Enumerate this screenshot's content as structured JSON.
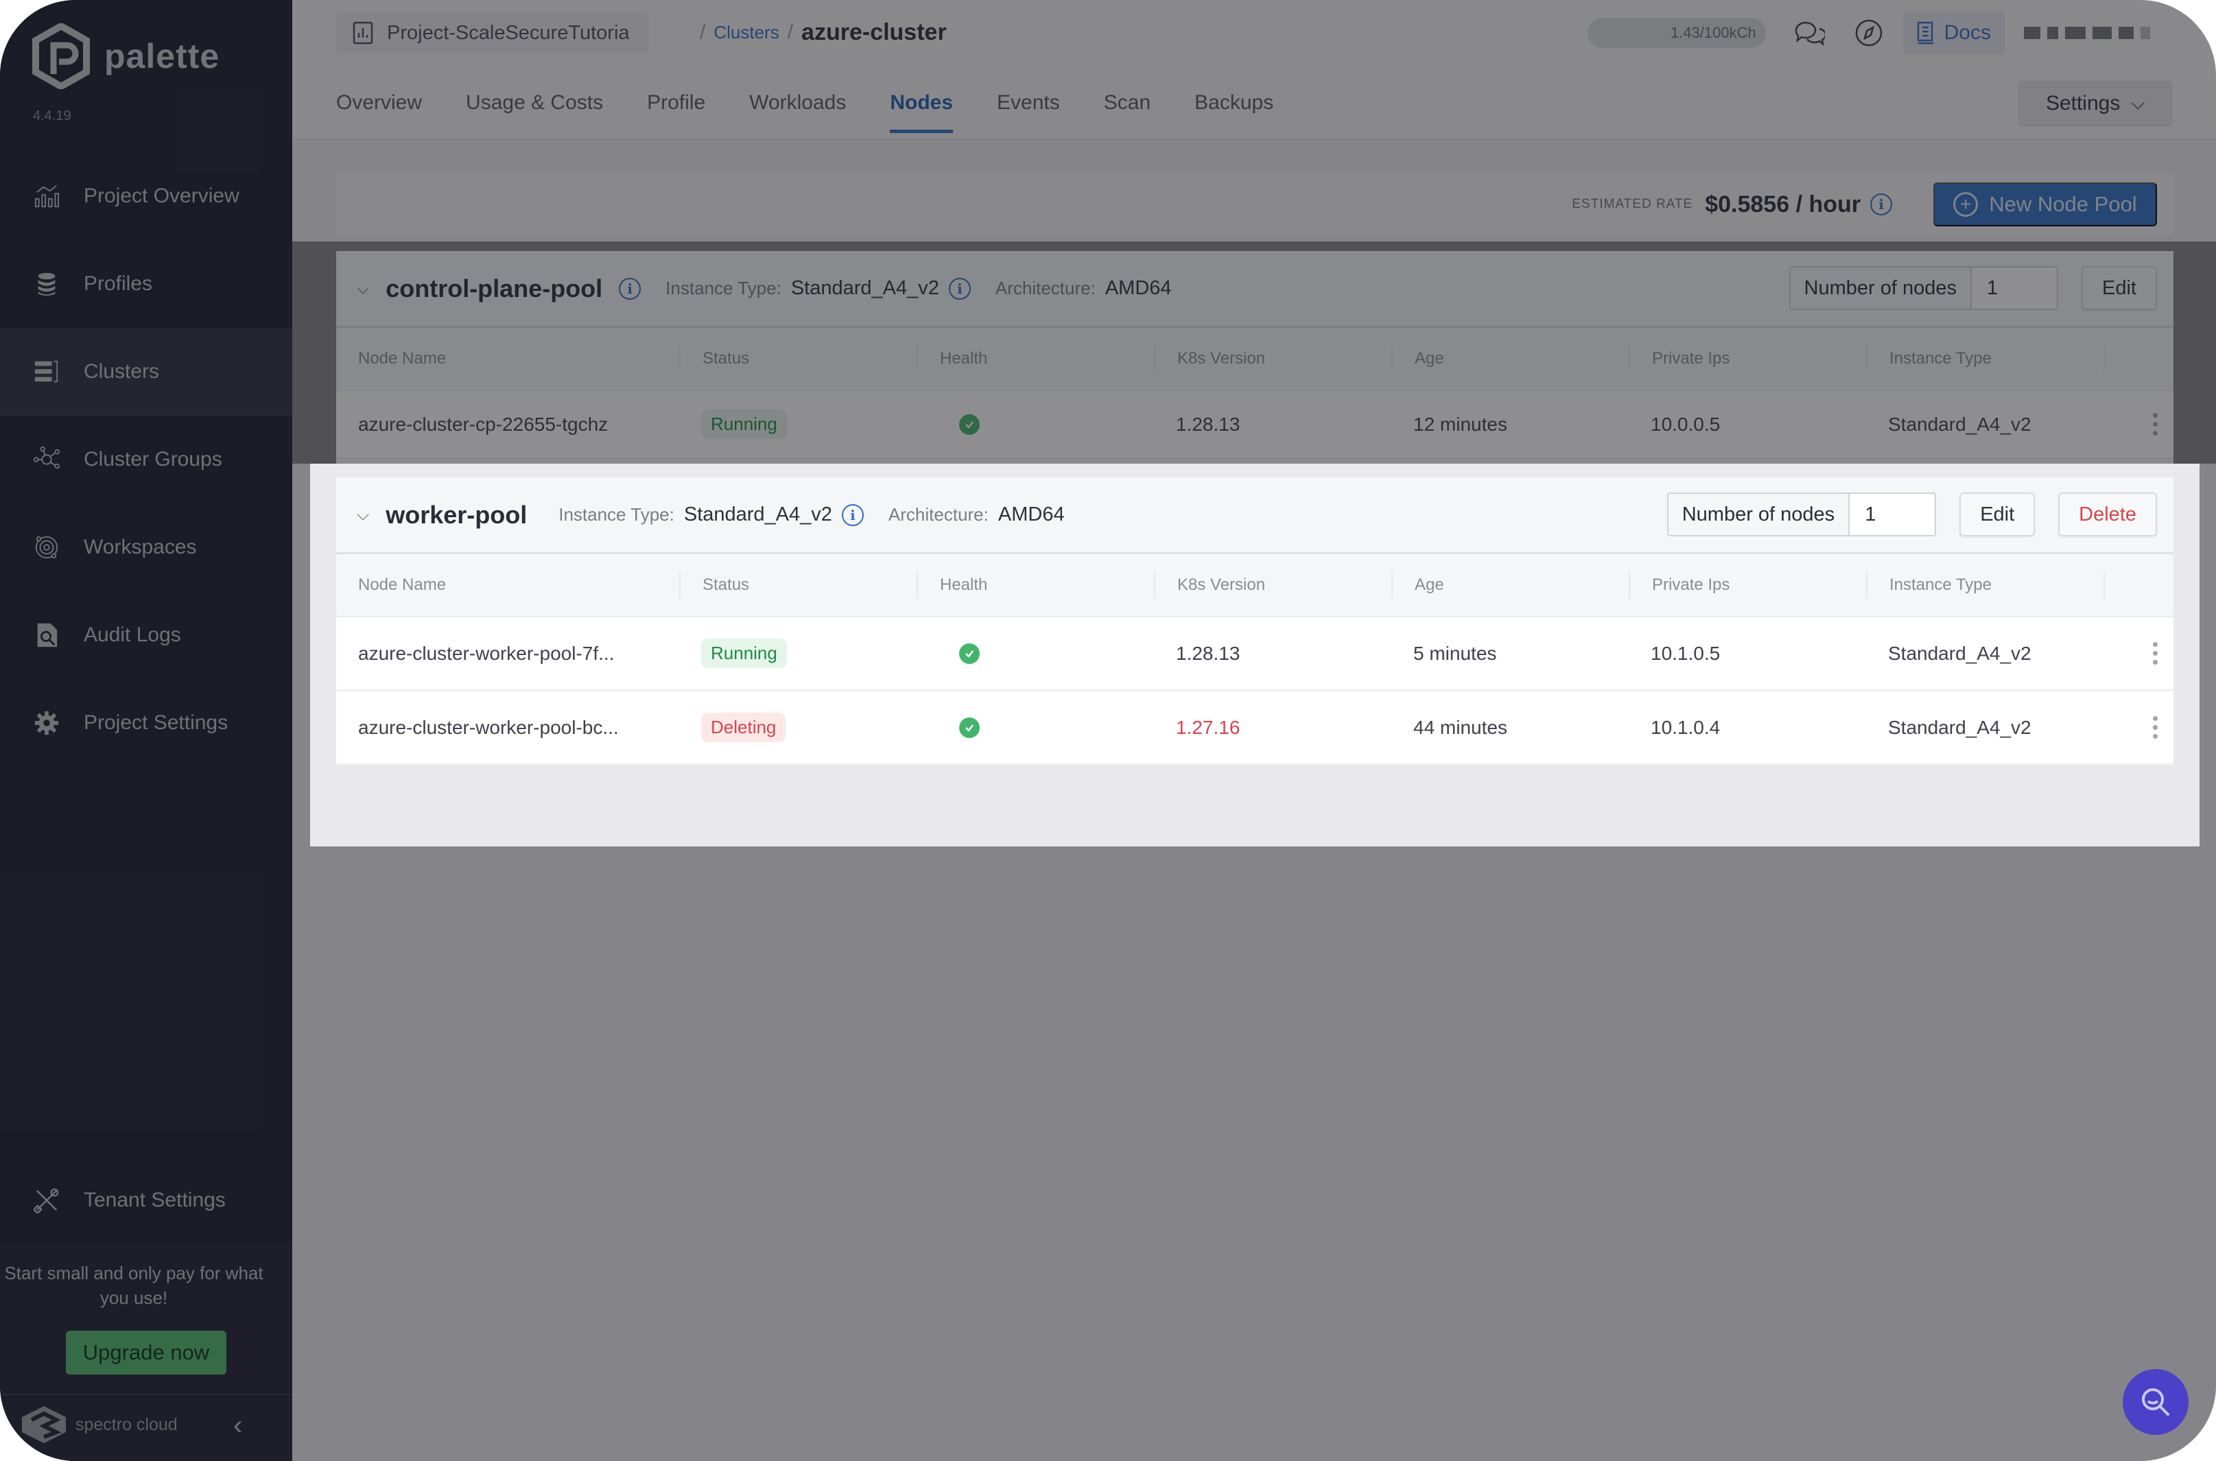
{
  "app": {
    "brand": "palette",
    "version": "4.4.19"
  },
  "sidebar": {
    "items": [
      {
        "label": "Project Overview",
        "icon": "chart-line-icon",
        "active": false
      },
      {
        "label": "Profiles",
        "icon": "layers-stack-icon",
        "active": false
      },
      {
        "label": "Clusters",
        "icon": "server-rack-icon",
        "active": true
      },
      {
        "label": "Cluster Groups",
        "icon": "network-nodes-icon",
        "active": false
      },
      {
        "label": "Workspaces",
        "icon": "orbit-target-icon",
        "active": false
      },
      {
        "label": "Audit Logs",
        "icon": "file-search-icon",
        "active": false
      },
      {
        "label": "Project Settings",
        "icon": "gear-icon",
        "active": false
      }
    ],
    "tenant_settings": "Tenant Settings",
    "promo_text": "Start small and only pay for what you use!",
    "upgrade_label": "Upgrade now",
    "footer_brand": "spectro cloud"
  },
  "header": {
    "project": "Project-ScaleSecureTutoria",
    "breadcrumb_link": "Clusters",
    "breadcrumb_current": "azure-cluster",
    "credits": "1.43/100kCh",
    "docs_label": "Docs",
    "tabs": [
      {
        "label": "Overview",
        "active": false
      },
      {
        "label": "Usage & Costs",
        "active": false
      },
      {
        "label": "Profile",
        "active": false
      },
      {
        "label": "Workloads",
        "active": false
      },
      {
        "label": "Nodes",
        "active": true
      },
      {
        "label": "Events",
        "active": false
      },
      {
        "label": "Scan",
        "active": false
      },
      {
        "label": "Backups",
        "active": false
      }
    ],
    "settings_label": "Settings"
  },
  "rate": {
    "label": "ESTIMATED RATE",
    "value": "$0.5856 / hour",
    "new_pool_label": "New Node Pool"
  },
  "columns": [
    "Node Name",
    "Status",
    "Health",
    "K8s Version",
    "Age",
    "Private Ips",
    "Instance Type"
  ],
  "pools": [
    {
      "name": "control-plane-pool",
      "instance_type_label": "Instance Type:",
      "instance_type": "Standard_A4_v2",
      "architecture_label": "Architecture:",
      "architecture": "AMD64",
      "node_count_label": "Number of nodes",
      "node_count": "1",
      "edit_label": "Edit",
      "rows": [
        {
          "name": "azure-cluster-cp-22655-tgchz",
          "status": "Running",
          "health": "healthy",
          "k8s": "1.28.13",
          "age": "12 minutes",
          "ip": "10.0.0.5",
          "instance": "Standard_A4_v2"
        }
      ]
    },
    {
      "name": "worker-pool",
      "instance_type_label": "Instance Type:",
      "instance_type": "Standard_A4_v2",
      "architecture_label": "Architecture:",
      "architecture": "AMD64",
      "node_count_label": "Number of nodes",
      "node_count": "1",
      "edit_label": "Edit",
      "delete_label": "Delete",
      "rows": [
        {
          "name": "azure-cluster-worker-pool-7f...",
          "status": "Running",
          "health": "healthy",
          "k8s": "1.28.13",
          "age": "5 minutes",
          "ip": "10.1.0.5",
          "instance": "Standard_A4_v2"
        },
        {
          "name": "azure-cluster-worker-pool-bc...",
          "status": "Deleting",
          "health": "healthy",
          "k8s": "1.27.16",
          "age": "44 minutes",
          "ip": "10.1.0.4",
          "instance": "Standard_A4_v2"
        }
      ]
    }
  ],
  "colors": {
    "accent": "#2f6fc4",
    "success": "#43b56a",
    "danger": "#d6464c",
    "sidebar_bg": "#1a1b2e",
    "upgrade": "#4dbb6a",
    "help_fab": "#4b40c8"
  }
}
